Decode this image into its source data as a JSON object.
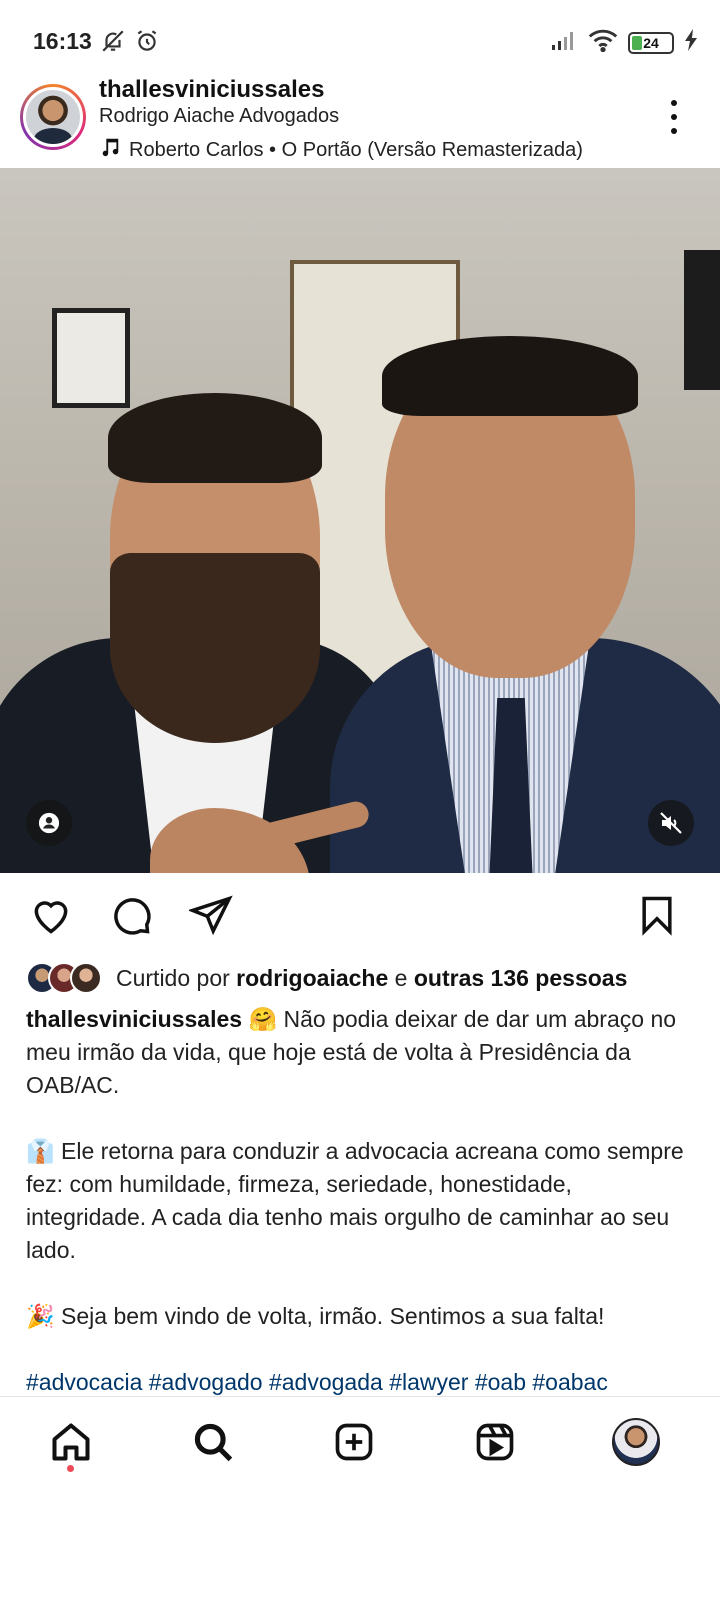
{
  "status_bar": {
    "time": "16:13",
    "battery": "24"
  },
  "post": {
    "username": "thallesviniciussales",
    "subtitle": "Rodrigo Aiache Advogados",
    "music": "Roberto Carlos • O Portão (Versão Remasterizada)"
  },
  "likes": {
    "prefix": "Curtido por",
    "user": "rodrigoaiache",
    "joiner": "e",
    "others": "outras 136 pessoas"
  },
  "caption": {
    "username": "thallesviniciussales",
    "emoji1": "🤗",
    "line1": "Não podia deixar de dar um abraço no meu irmão da vida, que hoje está de volta à Presidência da OAB/AC.",
    "emoji2": "👔",
    "line2": "Ele retorna para conduzir a advocacia acreana como sempre fez: com humildade, firmeza, seriedade, honestidade, integridade. A cada dia tenho mais orgulho de caminhar ao seu lado.",
    "emoji3": "🎉",
    "line3": "Seja bem vindo de volta, irmão. Sentimos a sua falta!",
    "hashtags": "#advocacia #advogado #advogada #lawyer #oab #oabac"
  },
  "icons": {
    "status": [
      "notifications-off-icon",
      "alarm-icon",
      "signal-icon",
      "wifi-icon",
      "battery-icon",
      "charging-icon"
    ],
    "header": [
      "music-note-icon",
      "more-options-icon"
    ],
    "actions": [
      "heart-icon",
      "comment-icon",
      "share-icon",
      "bookmark-icon"
    ],
    "nav": [
      "home-icon",
      "search-icon",
      "create-icon",
      "reels-icon",
      "profile-avatar"
    ]
  },
  "colors": {
    "link": "#00376b",
    "notification_dot": "#ed4956",
    "battery_fill": "#4caf50"
  }
}
